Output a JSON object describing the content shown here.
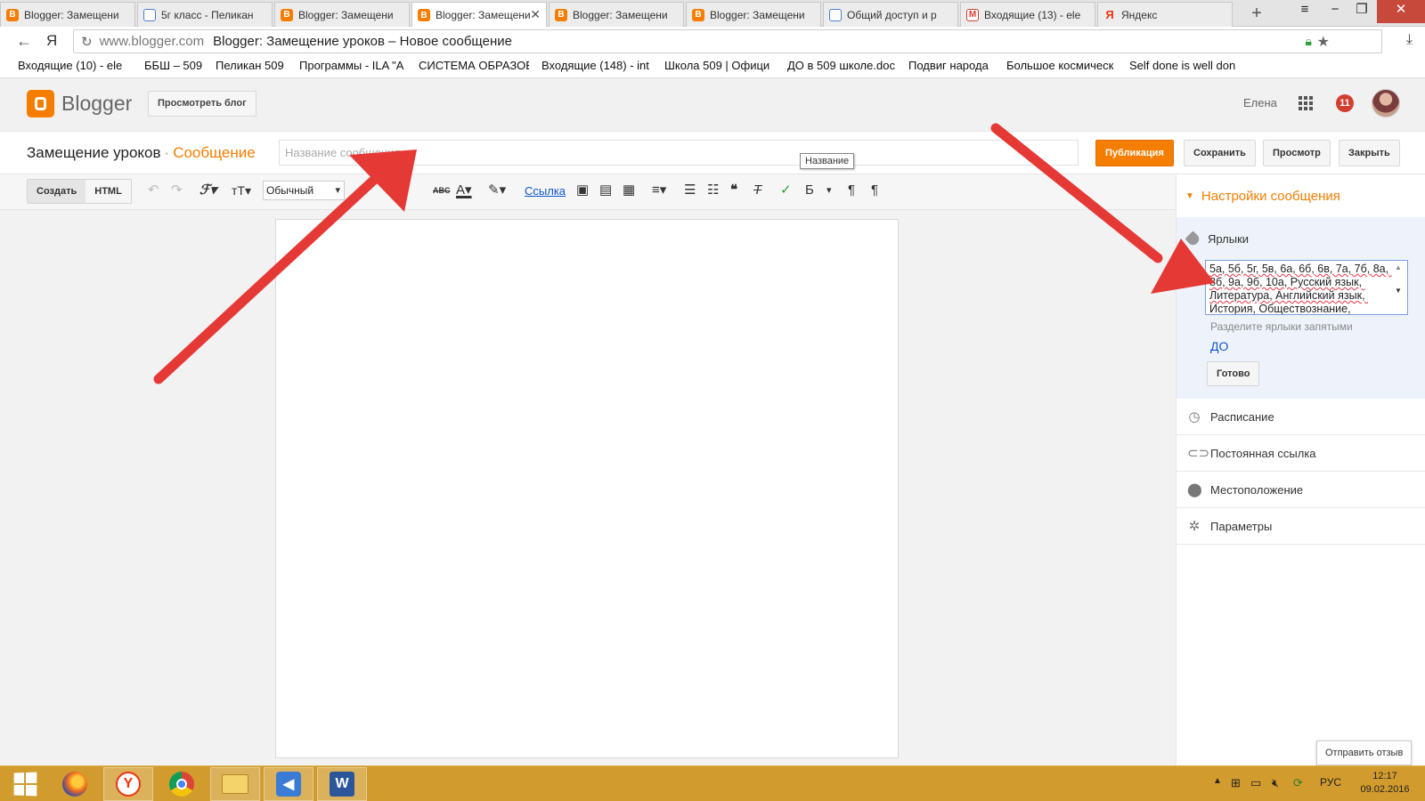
{
  "browser": {
    "tabs": [
      {
        "title": "Blogger: Замещени",
        "favicon": "blogger",
        "active": false
      },
      {
        "title": "5г класс - Пеликан",
        "favicon": "doc",
        "active": false
      },
      {
        "title": "Blogger: Замещени",
        "favicon": "blogger",
        "active": false
      },
      {
        "title": "Blogger: Замещени",
        "favicon": "blogger",
        "active": true
      },
      {
        "title": "Blogger: Замещени",
        "favicon": "blogger",
        "active": false
      },
      {
        "title": "Blogger: Замещени",
        "favicon": "blogger",
        "active": false
      },
      {
        "title": "Общий доступ и р",
        "favicon": "doc",
        "active": false
      },
      {
        "title": "Входящие (13) - ele",
        "favicon": "gmail",
        "active": false
      },
      {
        "title": "Яндекс",
        "favicon": "yandex",
        "active": false
      }
    ],
    "new_tab": "+",
    "back_icon": "←",
    "yandex_glyph": "Я",
    "reload_icon": "↻",
    "url_host": "www.blogger.com",
    "url_title": "Blogger: Замещение уроков – Новое сообщение",
    "bookmarks": [
      "Входящие (10) - ele",
      "ББШ – 509",
      "Пеликан 509",
      "Программы - ILA \"A",
      "СИСТЕМА ОБРАЗОВ",
      "Входящие (148) - int",
      "Школа 509 | Офици",
      "ДО в 509 школе.doc",
      "Подвиг народа",
      "Большое космическ",
      "Self done is well don"
    ]
  },
  "blogger": {
    "brand": "Blogger",
    "view_blog": "Просмотреть блог",
    "user_name": "Елена",
    "notifications": "11",
    "blog_title": "Замещение уроков",
    "separator": "·",
    "post_kind": "Сообщение",
    "title_placeholder": "Название сообщения",
    "tooltip": "Название",
    "buttons": {
      "publish": "Публикация",
      "save": "Сохранить",
      "preview": "Просмотр",
      "close": "Закрыть"
    }
  },
  "toolbar": {
    "compose": "Создать",
    "html": "HTML",
    "font_size_value": "Обычный",
    "link": "Ссылка",
    "strike_label": "ABC",
    "lang_letter": "Б"
  },
  "sidebar": {
    "header": "Настройки сообщения",
    "labels": {
      "title": "Ярлыки",
      "value": "5а, 5б, 5г, 5в, 6а, 6б, 6в, 7а, 7б, 8а, 8б, 9а, 9б, 10а, Русский язык, Литература, Английский язык, История, Обществознание,",
      "hint": "Разделите ярлыки запятыми",
      "suggestion": "ДО",
      "done": "Готово"
    },
    "items": [
      {
        "label": "Расписание",
        "icon": "clock-icon"
      },
      {
        "label": "Постоянная ссылка",
        "icon": "link-icon"
      },
      {
        "label": "Местоположение",
        "icon": "location-pin-icon"
      },
      {
        "label": "Параметры",
        "icon": "gear-icon"
      }
    ]
  },
  "feedback": "Отправить отзыв",
  "taskbar": {
    "lang": "РУС",
    "time": "12:17",
    "date": "09.02.2016"
  },
  "colors": {
    "accent": "#f57d00",
    "annotation_arrow": "#e53935",
    "taskbar": "#d29b2e",
    "link": "#1155cc"
  }
}
